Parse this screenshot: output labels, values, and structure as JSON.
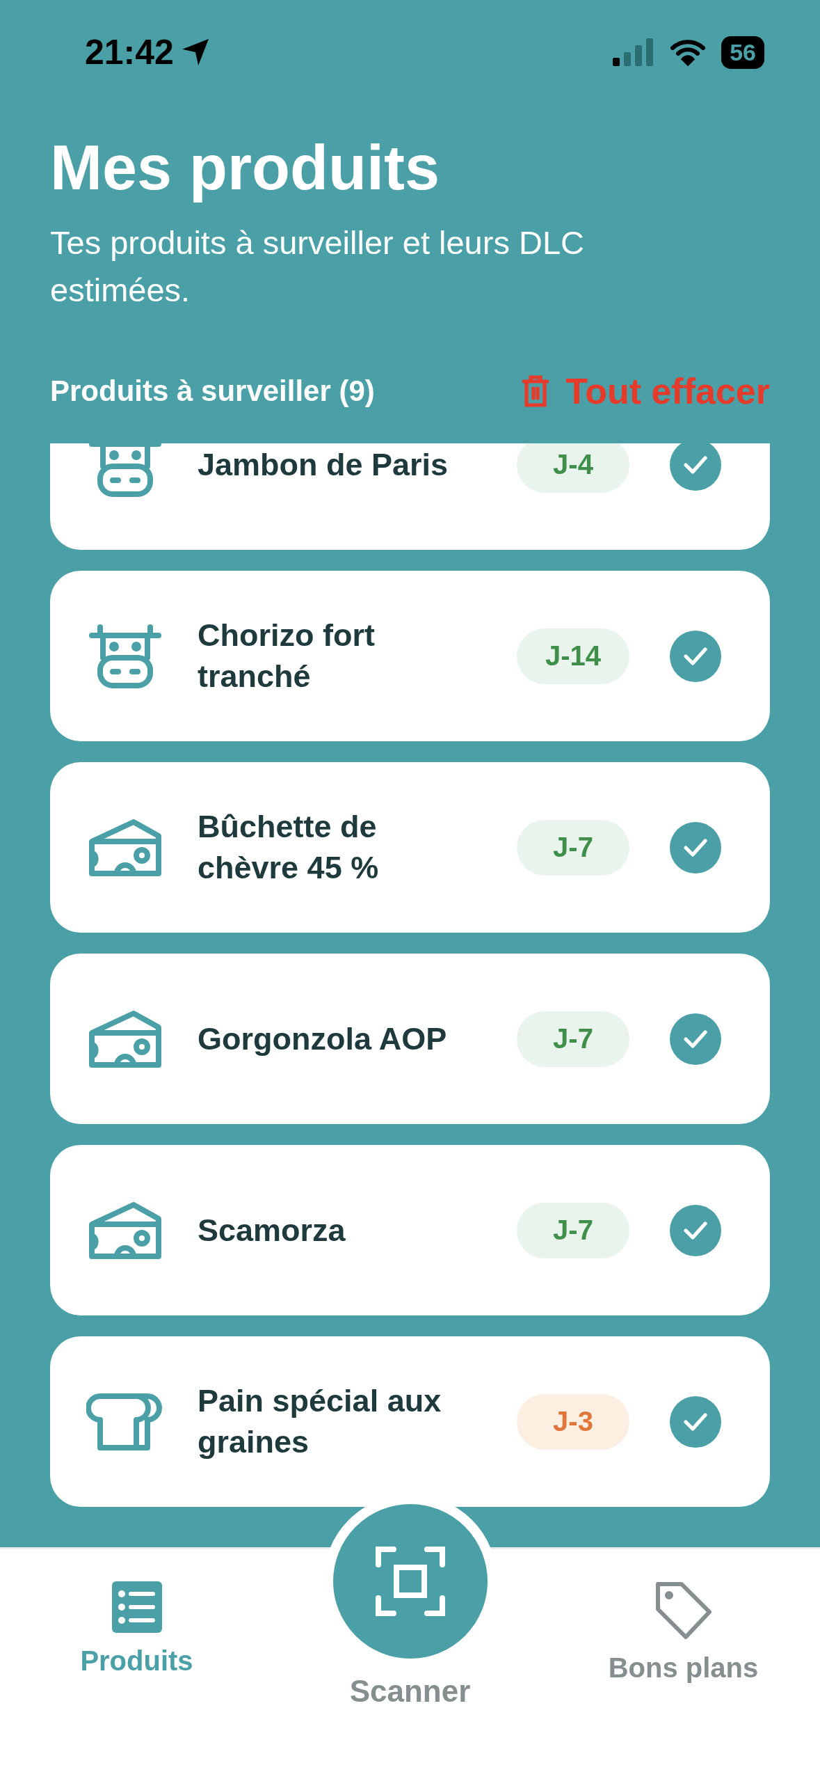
{
  "status_bar": {
    "time": "21:42",
    "battery": "56"
  },
  "header": {
    "title": "Mes produits",
    "subtitle": "Tes produits à surveiller et leurs DLC estimées."
  },
  "section": {
    "title": "Produits à surveiller (9)",
    "clear_button": "Tout effacer"
  },
  "products": [
    {
      "name": "Jambon de Paris",
      "kind": "meat",
      "badge": "J-4",
      "urgent": false
    },
    {
      "name": "Chorizo fort tranché",
      "kind": "meat",
      "badge": "J-14",
      "urgent": false
    },
    {
      "name": "Bûchette de chèvre 45 %",
      "kind": "cheese",
      "badge": "J-7",
      "urgent": false
    },
    {
      "name": "Gorgonzola AOP",
      "kind": "cheese",
      "badge": "J-7",
      "urgent": false
    },
    {
      "name": "Scamorza",
      "kind": "cheese",
      "badge": "J-7",
      "urgent": false
    },
    {
      "name": "Pain spécial aux graines",
      "kind": "bread",
      "badge": "J-3",
      "urgent": true
    }
  ],
  "nav": [
    {
      "label": "Produits",
      "kind": "list",
      "selected": true
    },
    {
      "label": "Scanner",
      "kind": "scan",
      "selected": false
    },
    {
      "label": "Bons plans",
      "kind": "tag",
      "selected": false
    }
  ]
}
